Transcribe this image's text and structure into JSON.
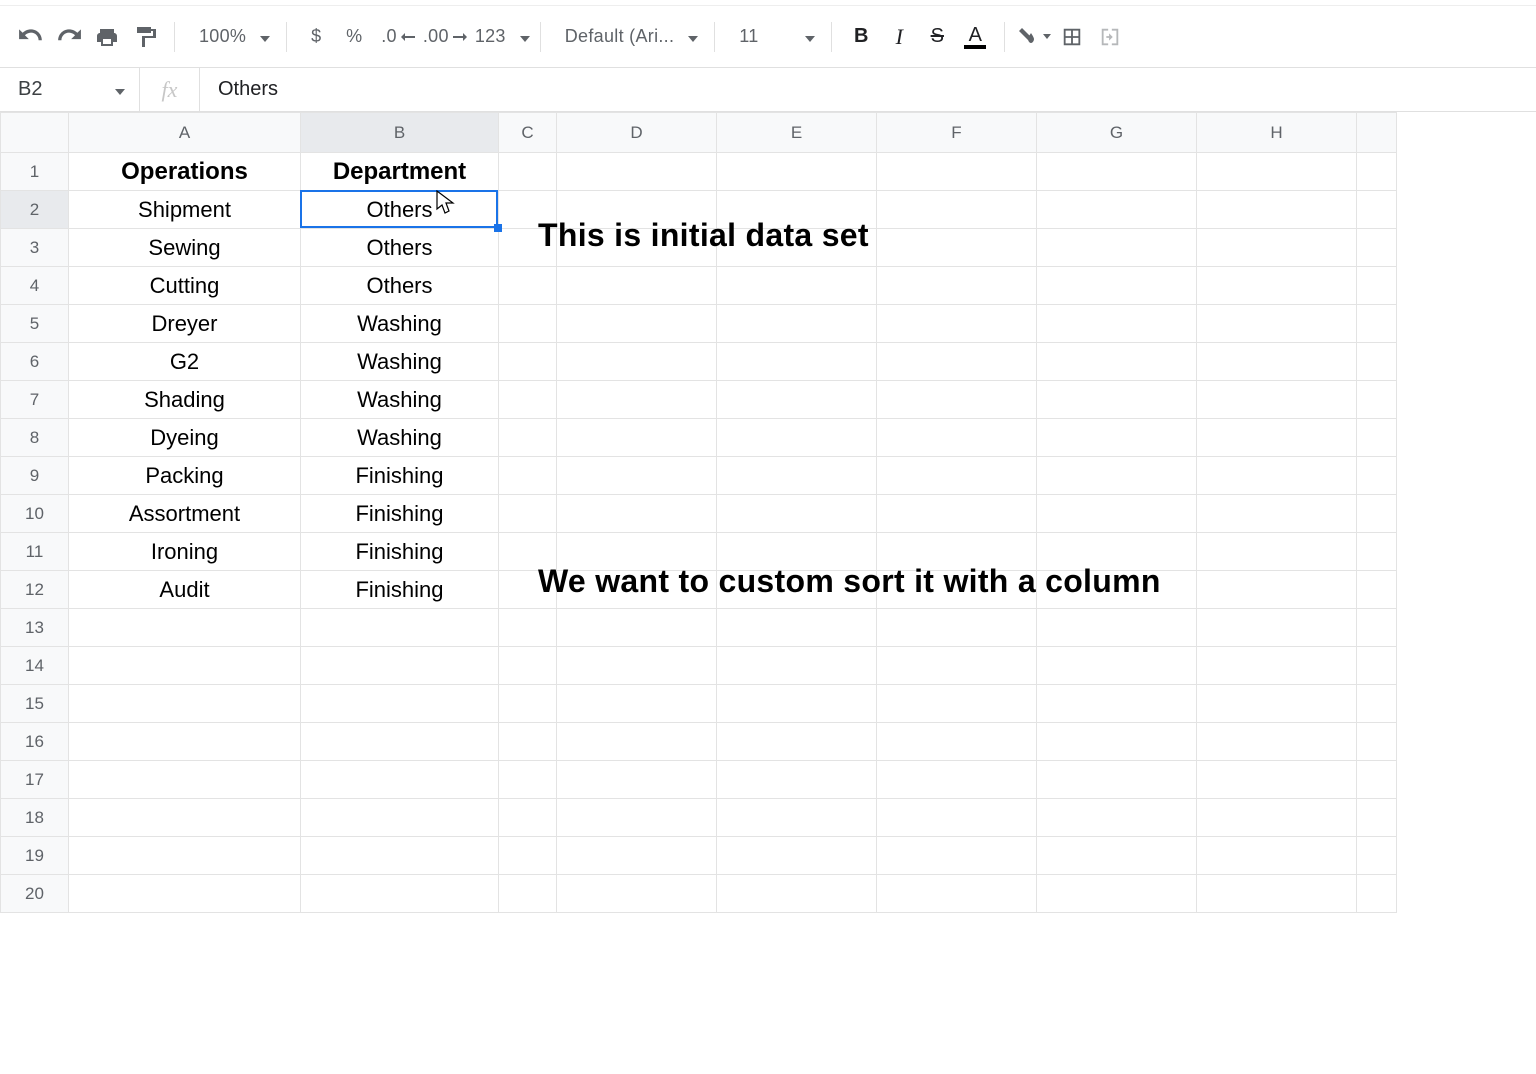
{
  "toolbar": {
    "zoom": "100%",
    "currency": "$",
    "percent": "%",
    "dec_dec": ".0",
    "inc_dec": ".00",
    "num_format": "123",
    "font": "Default (Ari...",
    "font_size": "11",
    "bold": "B",
    "italic": "I",
    "strike": "S",
    "text_color": "A"
  },
  "namebox": "B2",
  "fx_label": "fx",
  "formula_value": "Others",
  "columns": [
    "A",
    "B",
    "C",
    "D",
    "E",
    "F",
    "G",
    "H"
  ],
  "row_count": 20,
  "selected_cell": "B2",
  "headers": {
    "A": "Operations",
    "B": "Department"
  },
  "rows": [
    {
      "A": "Shipment",
      "B": "Others"
    },
    {
      "A": "Sewing",
      "B": "Others"
    },
    {
      "A": "Cutting",
      "B": "Others"
    },
    {
      "A": "Dreyer",
      "B": "Washing"
    },
    {
      "A": "G2",
      "B": "Washing"
    },
    {
      "A": "Shading",
      "B": "Washing"
    },
    {
      "A": "Dyeing",
      "B": "Washing"
    },
    {
      "A": "Packing",
      "B": "Finishing"
    },
    {
      "A": "Assortment",
      "B": "Finishing"
    },
    {
      "A": "Ironing",
      "B": "Finishing"
    },
    {
      "A": "Audit",
      "B": "Finishing"
    }
  ],
  "annotations": {
    "a1": "This is initial data set",
    "a2": "We want to custom sort it with a column"
  }
}
